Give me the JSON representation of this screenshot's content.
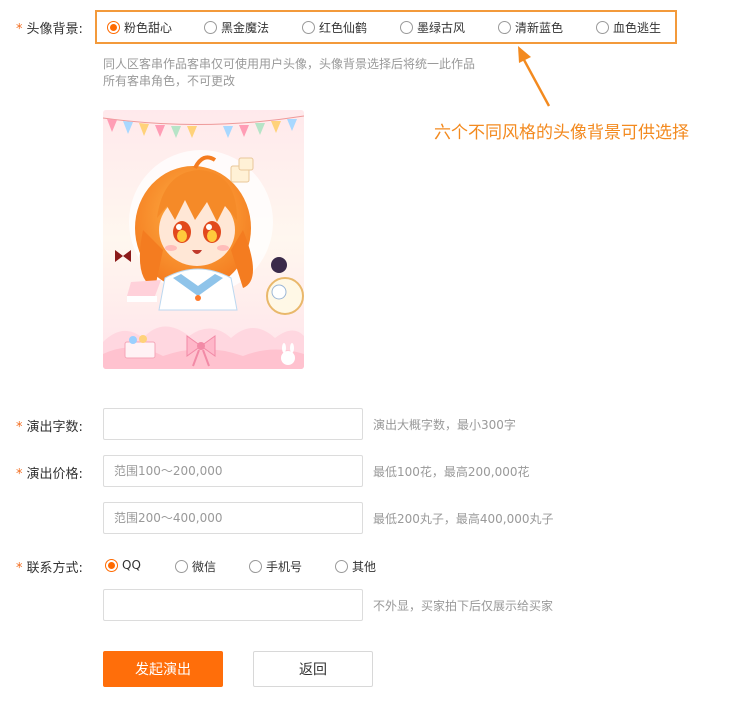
{
  "background": {
    "label": "头像背景:",
    "required_mark": "*",
    "options": [
      "粉色甜心",
      "黑金魔法",
      "红色仙鹤",
      "墨绿古风",
      "清新蓝色",
      "血色逃生"
    ],
    "selected": "粉色甜心",
    "hint_line1": "同人区客串作品客串仅可使用用户头像，头像背景选择后将统一此作品",
    "hint_line2": "所有客串角色，不可更改"
  },
  "annotation": "六个不同风格的头像背景可供选择",
  "word_count": {
    "label": "演出字数:",
    "required_mark": "*",
    "value": "",
    "placeholder": "",
    "hint": "演出大概字数，最小300字"
  },
  "price": {
    "label": "演出价格:",
    "required_mark": "*",
    "flower_placeholder": "范围100～200,000",
    "flower_hint": "最低100花，最高200,000花",
    "pill_placeholder": "范围200～400,000",
    "pill_hint": "最低200丸子，最高400,000丸子"
  },
  "contact": {
    "label": "联系方式:",
    "required_mark": "*",
    "options": [
      "QQ",
      "微信",
      "手机号",
      "其他"
    ],
    "selected": "QQ",
    "value": "",
    "hint": "不外显，买家拍下后仅展示给买家"
  },
  "actions": {
    "submit_label": "发起演出",
    "back_label": "返回"
  },
  "colors": {
    "accent": "#ff6e0a",
    "highlight_border": "#f39a3b",
    "annotation": "#f38a1f"
  }
}
